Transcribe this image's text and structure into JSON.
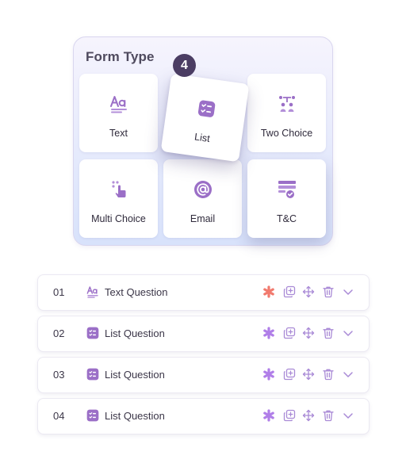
{
  "form_type": {
    "title": "Form Type",
    "tiles": [
      {
        "label": "Text",
        "icon": "text-format-icon"
      },
      {
        "label": "List",
        "icon": "list-icon"
      },
      {
        "label": "Two Choice",
        "icon": "two-choice-icon"
      },
      {
        "label": "Multi Choice",
        "icon": "multi-choice-icon"
      },
      {
        "label": "Email",
        "icon": "at-sign-icon"
      },
      {
        "label": "T&C",
        "icon": "terms-icon"
      }
    ],
    "drag_badge": "4"
  },
  "questions": [
    {
      "number": "01",
      "label": "Text Question",
      "icon": "text-format-icon",
      "required_color": "#f17a6e"
    },
    {
      "number": "02",
      "label": "List Question",
      "icon": "list-icon",
      "required_color": "#b07ee8"
    },
    {
      "number": "03",
      "label": "List Question",
      "icon": "list-icon",
      "required_color": "#b07ee8"
    },
    {
      "number": "04",
      "label": "List Question",
      "icon": "list-icon",
      "required_color": "#b07ee8"
    }
  ],
  "row_actions": [
    "required-icon",
    "duplicate-icon",
    "move-icon",
    "delete-icon",
    "chevron-down-icon"
  ],
  "colors": {
    "accent": "#9b6fc7",
    "accent_light": "#b38fd9",
    "badge": "#4b3d63",
    "required_active": "#f17a6e"
  }
}
